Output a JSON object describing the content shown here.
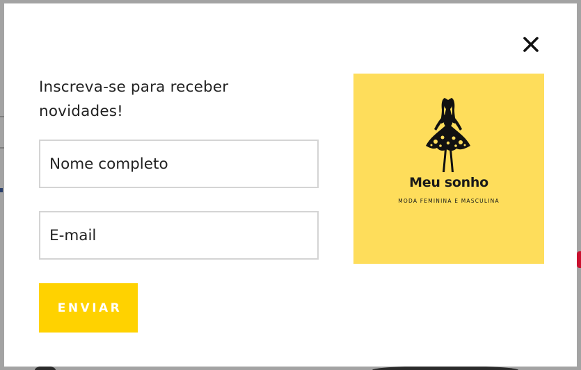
{
  "modal": {
    "heading": "Inscreva-se para receber novidades!",
    "close_label": "×",
    "form": {
      "name_placeholder": "Nome completo",
      "email_placeholder": "E-mail",
      "submit_label": "ENVIAR"
    },
    "brand": {
      "name": "Meu sonho",
      "tagline": "MODA FEMININA E MASCULINA"
    }
  },
  "colors": {
    "button": "#ffd200",
    "brand_card": "#fedd5b",
    "overlay": "#a3a3a3",
    "text": "#222222"
  },
  "icons": {
    "close": "close-icon",
    "logo": "woman-in-dress-logo"
  }
}
